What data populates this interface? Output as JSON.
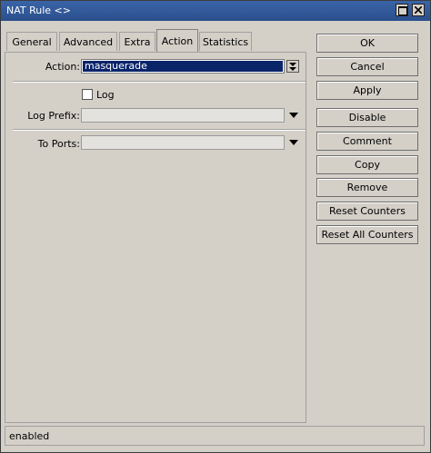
{
  "window": {
    "title": "NAT Rule <>"
  },
  "tabs": [
    {
      "label": "General"
    },
    {
      "label": "Advanced"
    },
    {
      "label": "Extra"
    },
    {
      "label": "Action",
      "active": true
    },
    {
      "label": "Statistics"
    }
  ],
  "form": {
    "action": {
      "label": "Action:",
      "value": "masquerade"
    },
    "log": {
      "label": "Log",
      "checked": false
    },
    "log_prefix": {
      "label": "Log Prefix:",
      "value": ""
    },
    "to_ports": {
      "label": "To Ports:",
      "value": ""
    }
  },
  "buttons": {
    "ok": "OK",
    "cancel": "Cancel",
    "apply": "Apply",
    "disable": "Disable",
    "comment": "Comment",
    "copy": "Copy",
    "remove": "Remove",
    "reset_counters": "Reset Counters",
    "reset_all_counters": "Reset All Counters"
  },
  "status": {
    "text": "enabled"
  },
  "colors": {
    "titlebar": "#2f5797",
    "selection": "#0a246a",
    "background": "#d4d0c8"
  }
}
